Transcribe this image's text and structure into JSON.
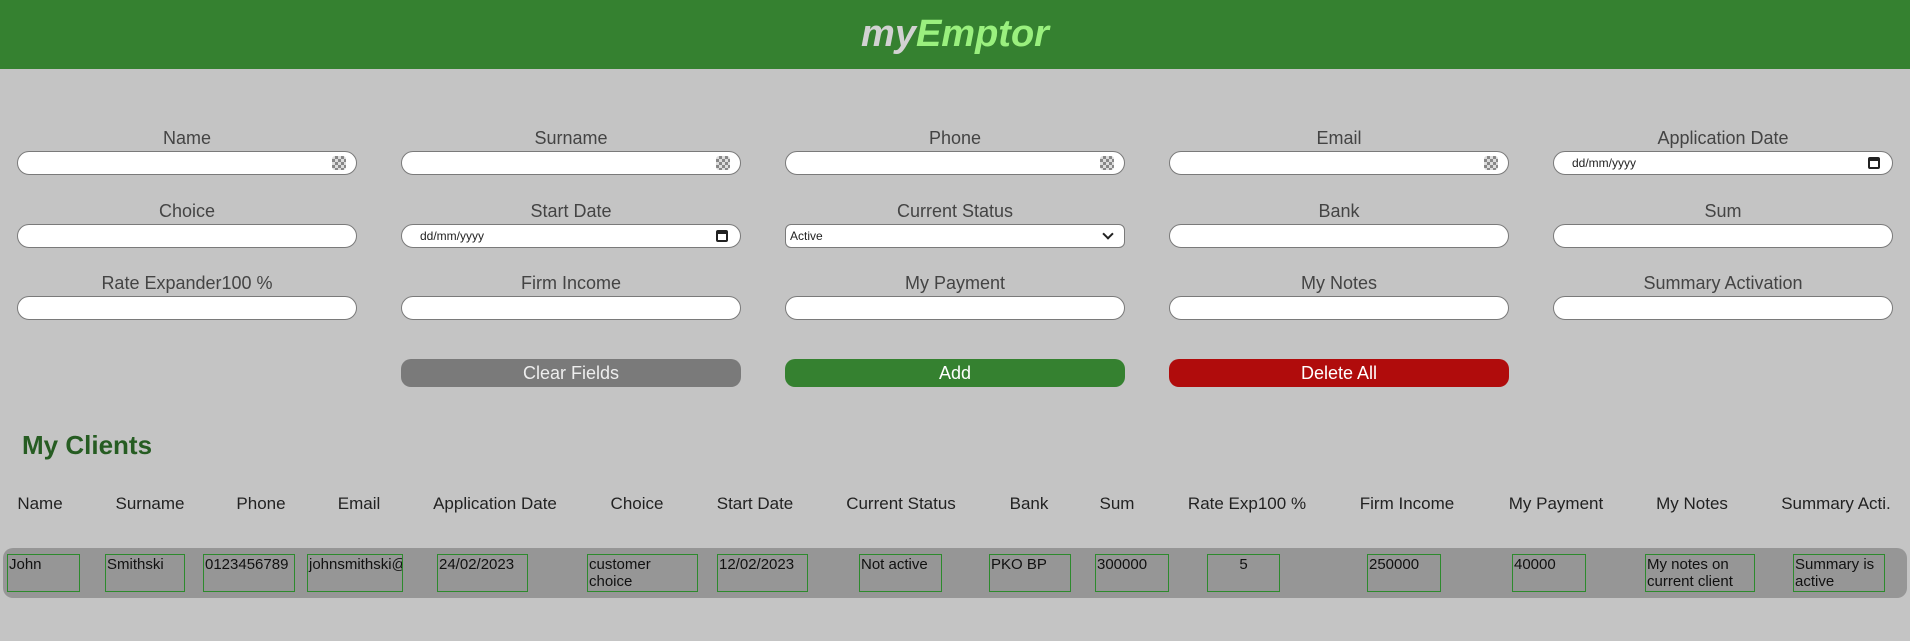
{
  "header": {
    "logo_my": "my",
    "logo_emptor": "Emptor"
  },
  "form": {
    "name": {
      "label": "Name",
      "value": ""
    },
    "surname": {
      "label": "Surname",
      "value": ""
    },
    "phone": {
      "label": "Phone",
      "value": ""
    },
    "email": {
      "label": "Email",
      "value": ""
    },
    "application_date": {
      "label": "Application Date",
      "placeholder": "dd/mm/yyyy"
    },
    "choice": {
      "label": "Choice",
      "value": ""
    },
    "start_date": {
      "label": "Start Date",
      "placeholder": "dd/mm/yyyy"
    },
    "current_status": {
      "label": "Current Status",
      "selected": "Active"
    },
    "bank": {
      "label": "Bank",
      "value": ""
    },
    "sum": {
      "label": "Sum",
      "value": ""
    },
    "rate_expander": {
      "label": "Rate Expander100 %",
      "value": ""
    },
    "firm_income": {
      "label": "Firm Income",
      "value": ""
    },
    "my_payment": {
      "label": "My Payment",
      "value": ""
    },
    "my_notes": {
      "label": "My Notes",
      "value": ""
    },
    "summary_activation": {
      "label": "Summary Activation",
      "value": ""
    }
  },
  "buttons": {
    "clear": "Clear Fields",
    "add": "Add",
    "delete_all": "Delete All"
  },
  "clients": {
    "title": "My Clients",
    "columns": [
      "Name",
      "Surname",
      "Phone",
      "Email",
      "Application Date",
      "Choice",
      "Start Date",
      "Current Status",
      "Bank",
      "Sum",
      "Rate Exp100 %",
      "Firm Income",
      "My Payment",
      "My Notes",
      "Summary Acti."
    ],
    "rows": [
      [
        "John",
        "Smithski",
        "0123456789",
        "johnsmithski@gmail.com",
        "24/02/2023",
        "customer choice",
        "12/02/2023",
        "Not active",
        "PKO BP",
        "300000",
        "5",
        "250000",
        "40000",
        "My notes on current client",
        "Summary is active"
      ]
    ]
  },
  "colors": {
    "header_bg": "#358130",
    "logo_accent": "#9af07e",
    "add_button": "#358130",
    "delete_button": "#b00c0c",
    "clear_button": "#7a7a7a",
    "title_color": "#265c22"
  }
}
